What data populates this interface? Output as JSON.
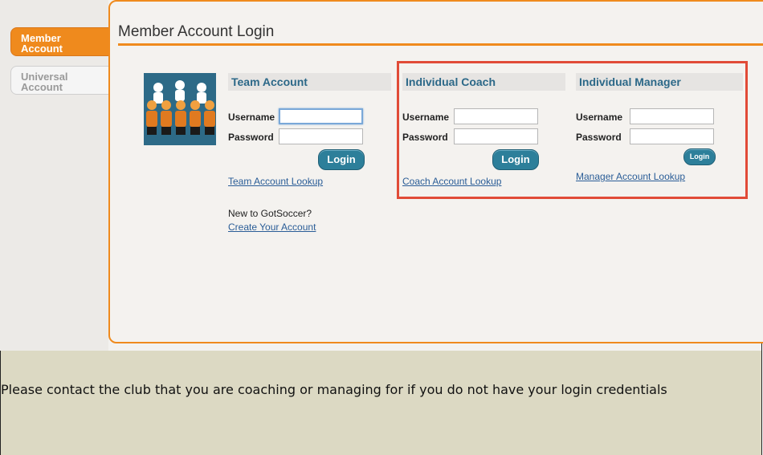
{
  "tabs": {
    "member": [
      "Member",
      "Account"
    ],
    "universal": [
      "Universal",
      "Account"
    ]
  },
  "page": {
    "title": "Member Account Login"
  },
  "team": {
    "heading": "Team Account",
    "username_label": "Username",
    "password_label": "Password",
    "login_label": "Login",
    "lookup_link": "Team Account Lookup",
    "new_text": "New to GotSoccer?",
    "create_link": "Create Your Account"
  },
  "coach": {
    "heading": "Individual Coach",
    "username_label": "Username",
    "password_label": "Password",
    "login_label": "Login",
    "lookup_link": "Coach Account Lookup"
  },
  "manager": {
    "heading": "Individual Manager",
    "username_label": "Username",
    "password_label": "Password",
    "login_label": "Login",
    "lookup_link": "Manager Account Lookup"
  },
  "footer": {
    "message": "Please contact the club that you are coaching or managing for if you do not have your login credentials"
  },
  "colors": {
    "accent": "#ef8a1d",
    "heading": "#2c6888",
    "button": "#2d7f9a",
    "highlight": "#e14b37",
    "footer_bg": "#dcd9c3"
  }
}
